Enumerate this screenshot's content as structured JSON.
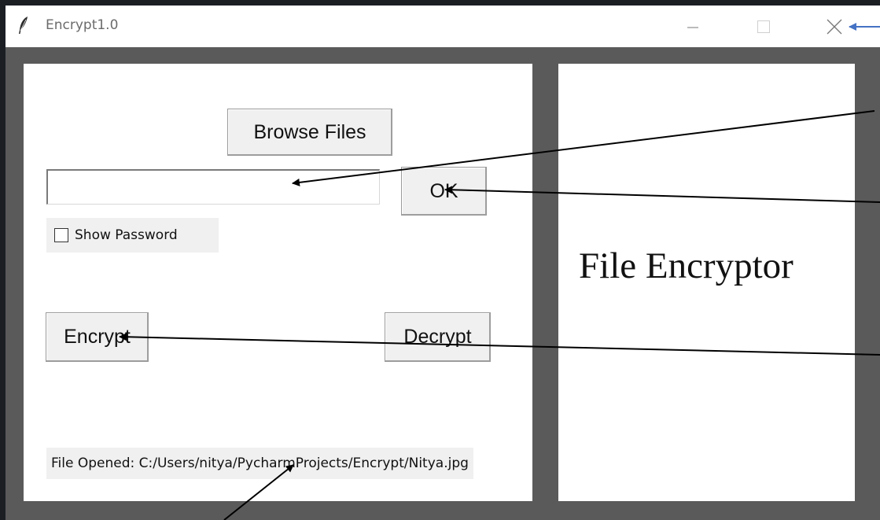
{
  "window": {
    "title": "Encrypt1.0",
    "controls": [
      "minimize",
      "maximize",
      "close"
    ]
  },
  "left_panel": {
    "browse_label": "Browse Files",
    "password_value": "",
    "ok_label": "OK",
    "show_password_label": "Show Password",
    "show_password_checked": false,
    "encrypt_label": "Encrypt",
    "decrypt_label": "Decrypt",
    "status_text": "File Opened: C:/Users/nitya/PycharmProjects/Encrypt/Nitya.jpg"
  },
  "right_panel": {
    "heading": "File Encryptor"
  },
  "colors": {
    "window_border": "#5a5a5a",
    "panel_bg": "#ffffff",
    "button_bg": "#f0f0f0",
    "close_arrow": "#4472c4",
    "annotation_arrow": "#000000"
  },
  "icons": [
    "feather-icon",
    "minimize-icon",
    "maximize-icon",
    "close-icon"
  ]
}
